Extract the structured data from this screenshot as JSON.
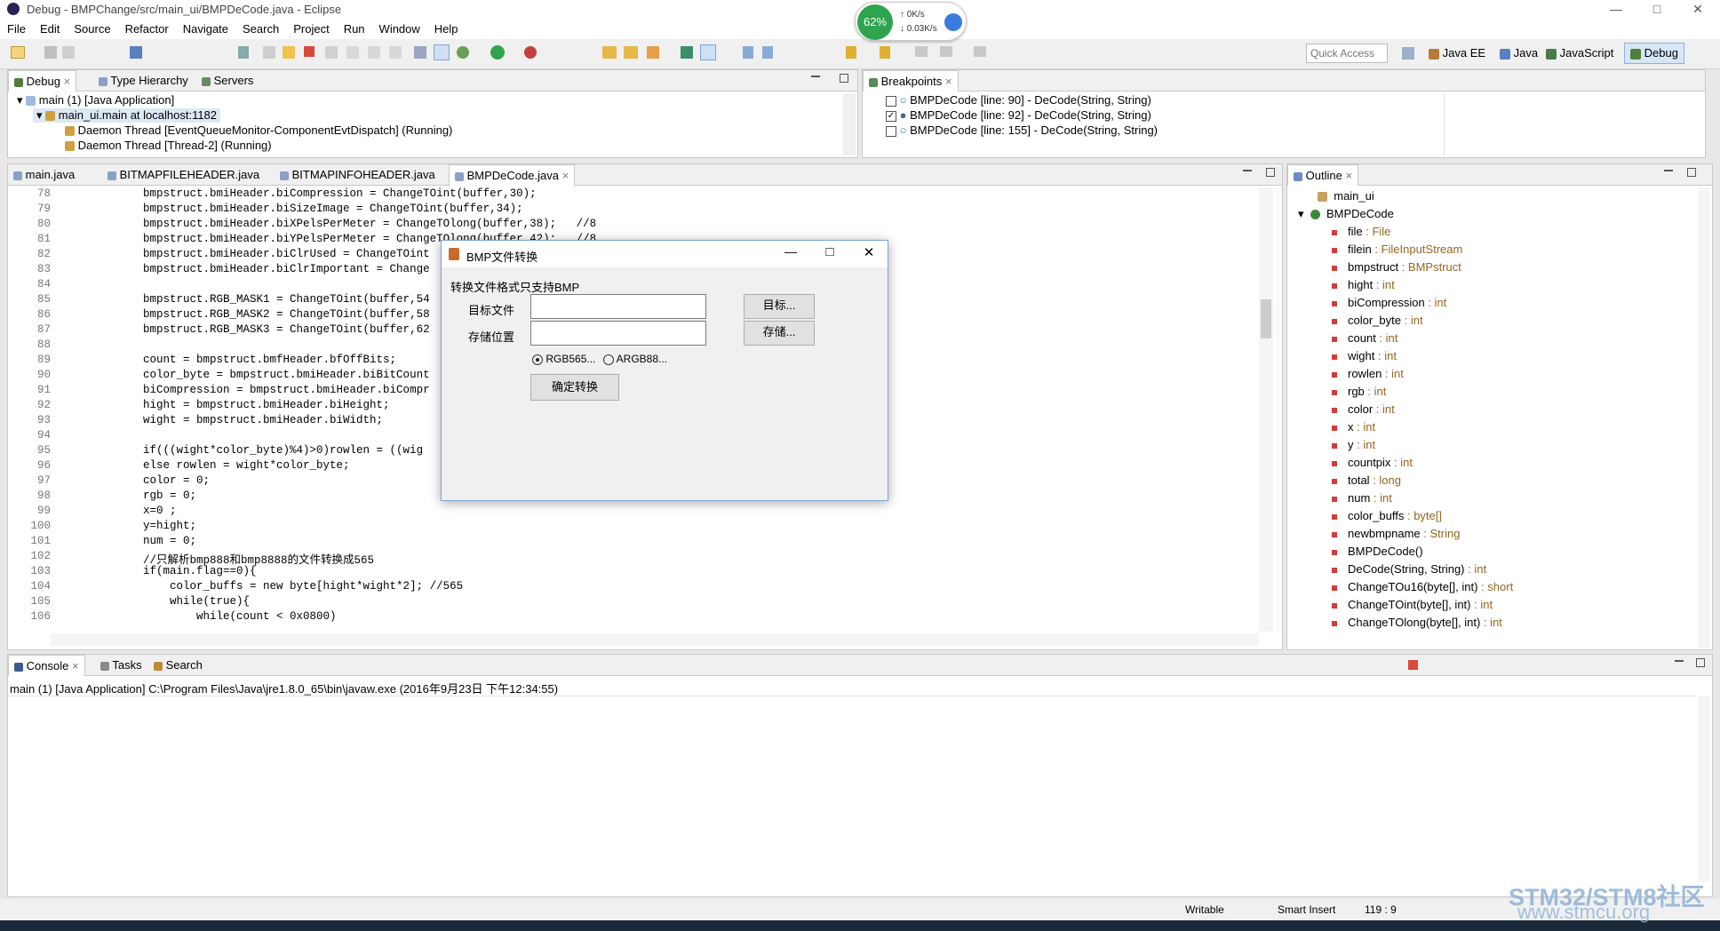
{
  "window": {
    "title": "Debug - BMPChange/src/main_ui/BMPDeCode.java - Eclipse"
  },
  "menu": [
    "File",
    "Edit",
    "Source",
    "Refactor",
    "Navigate",
    "Search",
    "Project",
    "Run",
    "Window",
    "Help"
  ],
  "netmon": {
    "percent": "62%",
    "up": "0K/s",
    "down": "0.03K/s"
  },
  "quick_access": {
    "placeholder": "Quick Access"
  },
  "perspectives": [
    "Java EE",
    "Java",
    "JavaScript",
    "Debug"
  ],
  "debug_view": {
    "tabs": [
      "Debug",
      "Type Hierarchy",
      "Servers"
    ],
    "tree": [
      "main (1) [Java Application]",
      "main_ui.main at localhost:1182",
      "Daemon Thread [EventQueueMonitor-ComponentEvtDispatch] (Running)",
      "Daemon Thread [Thread-2] (Running)"
    ]
  },
  "breakpoints": {
    "tab": "Breakpoints",
    "items": [
      {
        "label": "BMPDeCode [line: 90] - DeCode(String, String)",
        "checked": false
      },
      {
        "label": "BMPDeCode [line: 92] - DeCode(String, String)",
        "checked": true
      },
      {
        "label": "BMPDeCode [line: 155] - DeCode(String, String)",
        "checked": false
      }
    ]
  },
  "editor": {
    "tabs": [
      "main.java",
      "BITMAPFILEHEADER.java",
      "BITMAPINFOHEADER.java",
      "BMPDeCode.java"
    ],
    "lines": [
      {
        "n": "78",
        "t": "            bmpstruct.bmiHeader.biCompression = ChangeTOint(buffer,30);"
      },
      {
        "n": "79",
        "t": "            bmpstruct.bmiHeader.biSizeImage = ChangeTOint(buffer,34);"
      },
      {
        "n": "80",
        "t": "            bmpstruct.bmiHeader.biXPelsPerMeter = ChangeTOlong(buffer,38);   //8"
      },
      {
        "n": "81",
        "t": "            bmpstruct.bmiHeader.biYPelsPerMeter = ChangeTOlong(buffer,42);   //8"
      },
      {
        "n": "82",
        "t": "            bmpstruct.bmiHeader.biClrUsed = ChangeTOint"
      },
      {
        "n": "83",
        "t": "            bmpstruct.bmiHeader.biClrImportant = Change"
      },
      {
        "n": "84",
        "t": ""
      },
      {
        "n": "85",
        "t": "            bmpstruct.RGB_MASK1 = ChangeTOint(buffer,54"
      },
      {
        "n": "86",
        "t": "            bmpstruct.RGB_MASK2 = ChangeTOint(buffer,58"
      },
      {
        "n": "87",
        "t": "            bmpstruct.RGB_MASK3 = ChangeTOint(buffer,62"
      },
      {
        "n": "88",
        "t": ""
      },
      {
        "n": "89",
        "t": "            count = bmpstruct.bmfHeader.bfOffBits;"
      },
      {
        "n": "90",
        "t": "            color_byte = bmpstruct.bmiHeader.biBitCount"
      },
      {
        "n": "91",
        "t": "            biCompression = bmpstruct.bmiHeader.biCompr"
      },
      {
        "n": "92",
        "t": "            hight = bmpstruct.bmiHeader.biHeight;"
      },
      {
        "n": "93",
        "t": "            wight = bmpstruct.bmiHeader.biWidth;"
      },
      {
        "n": "94",
        "t": ""
      },
      {
        "n": "95",
        "t": "            if(((wight*color_byte)%4)>0)rowlen = ((wig"
      },
      {
        "n": "96",
        "t": "            else rowlen = wight*color_byte;"
      },
      {
        "n": "97",
        "t": "            color = 0;"
      },
      {
        "n": "98",
        "t": "            rgb = 0;"
      },
      {
        "n": "99",
        "t": "            x=0 ;"
      },
      {
        "n": "100",
        "t": "            y=hight;"
      },
      {
        "n": "101",
        "t": "            num = 0;"
      },
      {
        "n": "102",
        "t": "            //只解析bmp888和bmp8888的文件转换成565"
      },
      {
        "n": "103",
        "t": "            if(main.flag==0){"
      },
      {
        "n": "104",
        "t": "                color_buffs = new byte[hight*wight*2]; //565"
      },
      {
        "n": "105",
        "t": "                while(true){"
      },
      {
        "n": "106",
        "t": "                    while(count < 0x0800)"
      }
    ]
  },
  "outline": {
    "tab": "Outline",
    "package": "main_ui",
    "class": "BMPDeCode",
    "members": [
      {
        "name": "file",
        "type": " : File"
      },
      {
        "name": "filein",
        "type": " : FileInputStream"
      },
      {
        "name": "bmpstruct",
        "type": " : BMPstruct"
      },
      {
        "name": "hight",
        "type": " : int"
      },
      {
        "name": "biCompression",
        "type": " : int"
      },
      {
        "name": "color_byte",
        "type": " : int"
      },
      {
        "name": "count",
        "type": " : int"
      },
      {
        "name": "wight",
        "type": " : int"
      },
      {
        "name": "rowlen",
        "type": " : int"
      },
      {
        "name": "rgb",
        "type": " : int"
      },
      {
        "name": "color",
        "type": " : int"
      },
      {
        "name": "x",
        "type": " : int"
      },
      {
        "name": "y",
        "type": " : int"
      },
      {
        "name": "countpix",
        "type": " : int"
      },
      {
        "name": "total",
        "type": " : long"
      },
      {
        "name": "num",
        "type": " : int"
      },
      {
        "name": "color_buffs",
        "type": " : byte[]"
      },
      {
        "name": "newbmpname",
        "type": " : String"
      },
      {
        "name": "BMPDeCode()",
        "type": ""
      },
      {
        "name": "DeCode(String, String)",
        "type": " : int"
      },
      {
        "name": "ChangeTOu16(byte[], int)",
        "type": " : short"
      },
      {
        "name": "ChangeTOint(byte[], int)",
        "type": " : int"
      },
      {
        "name": "ChangeTOlong(byte[], int)",
        "type": " : int"
      }
    ]
  },
  "console": {
    "tabs": [
      "Console",
      "Tasks",
      "Search"
    ],
    "header": "main (1) [Java Application] C:\\Program Files\\Java\\jre1.8.0_65\\bin\\javaw.exe (2016年9月23日 下午12:34:55)"
  },
  "statusbar": {
    "writable": "Writable",
    "insert": "Smart Insert",
    "pos": "119 : 9"
  },
  "watermark": {
    "line1": "STM32/STM8社区",
    "line2": "www.stmcu.org"
  },
  "dialog": {
    "title": "BMP文件转换",
    "note": "转换文件格式只支持BMP",
    "target_label": "目标文件",
    "save_label": "存储位置",
    "target_btn": "目标...",
    "save_btn": "存储...",
    "radio1": "RGB565...",
    "radio2": "ARGB88...",
    "convert_btn": "确定转换"
  }
}
